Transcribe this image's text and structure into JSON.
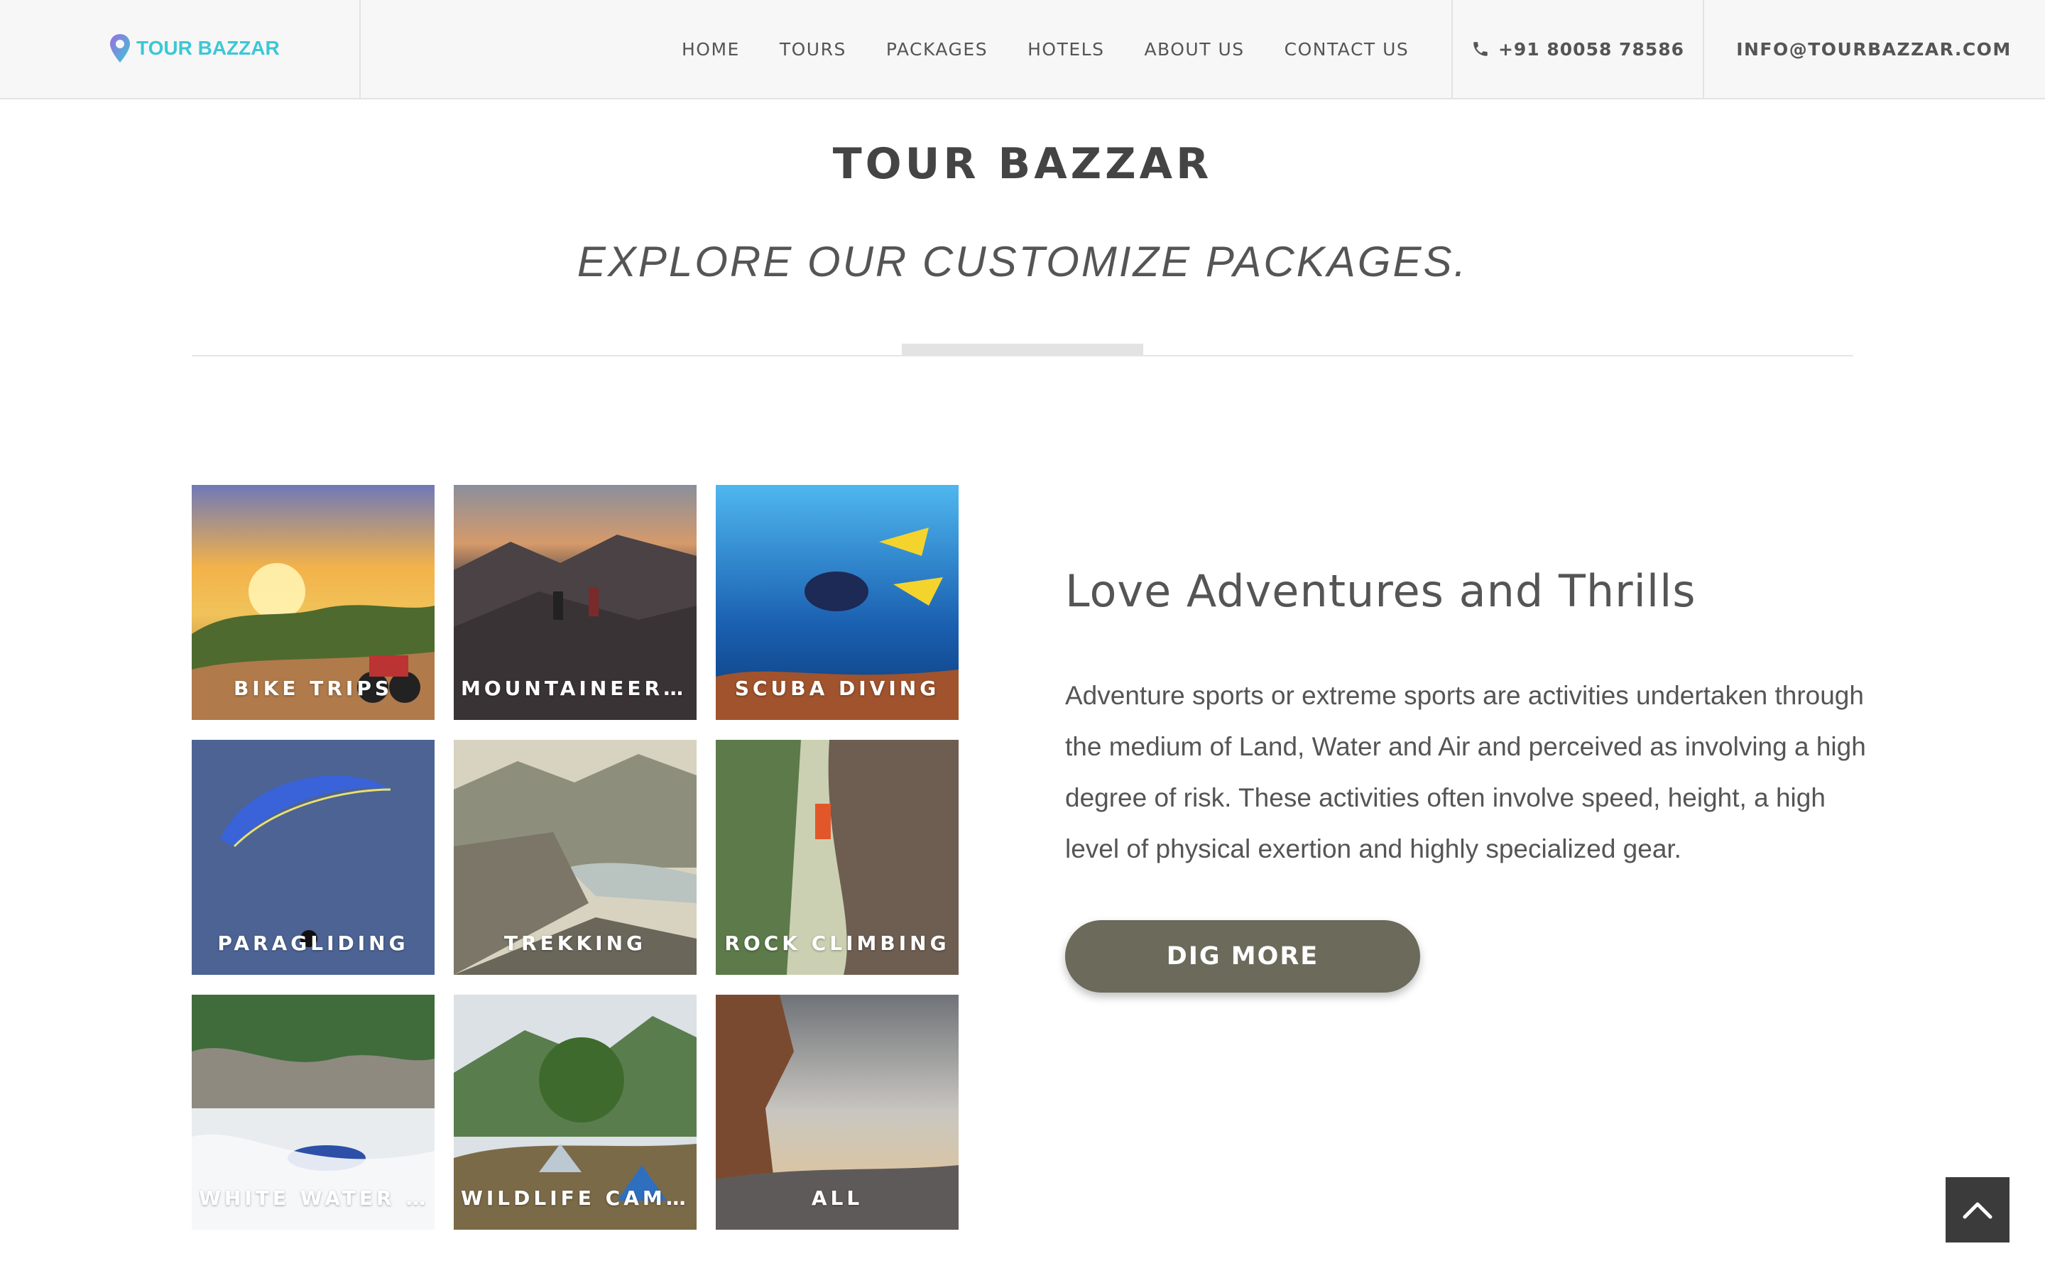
{
  "header": {
    "logo_text": "TOUR BAZZAR",
    "nav": [
      "HOME",
      "TOURS",
      "PACKAGES",
      "HOTELS",
      "ABOUT US",
      "CONTACT US"
    ],
    "phone": "+91 80058 78586",
    "email": "INFO@TOURBAZZAR.COM"
  },
  "page": {
    "title": "TOUR BAZZAR",
    "subtitle": "EXPLORE OUR CUSTOMIZE PACKAGES."
  },
  "tiles": [
    {
      "label": "BIKE TRIPS"
    },
    {
      "label": "MOUNTAINEERING"
    },
    {
      "label": "SCUBA DIVING"
    },
    {
      "label": "PARAGLIDING"
    },
    {
      "label": "TREKKING"
    },
    {
      "label": "ROCK CLIMBING"
    },
    {
      "label": "WHITE WATER RAFTING"
    },
    {
      "label": "WILDLIFE CAMPING"
    },
    {
      "label": "ALL"
    }
  ],
  "content": {
    "heading": "Love Adventures and Thrills",
    "body": "Adventure sports or extreme sports are activities undertaken through the medium of Land, Water and Air and perceived as involving a high degree of risk. These activities often involve speed, height, a high level of physical exertion and highly specialized gear.",
    "button": "DIG MORE"
  },
  "icons": {
    "logo": "location-pin-icon",
    "phone": "phone-icon",
    "scroll_top": "chevron-up-icon"
  },
  "colors": {
    "logo": "#3cc7d6",
    "button": "#6b6a5b",
    "scroll_top": "#3b3b3b",
    "text": "#555555"
  }
}
